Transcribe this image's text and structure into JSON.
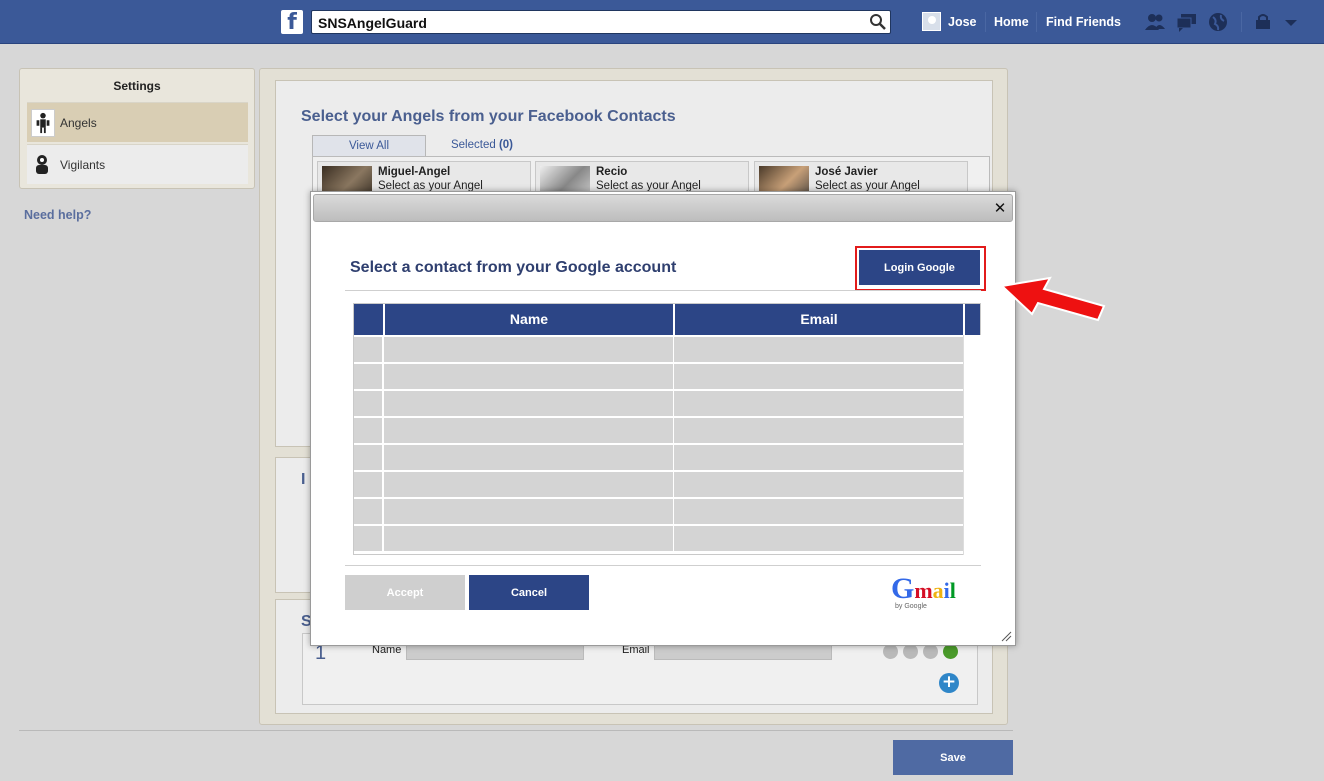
{
  "topbar": {
    "search_value": "SNSAngelGuard",
    "user_name": "Jose",
    "home": "Home",
    "find_friends": "Find Friends",
    "brand_color": "#3b5998"
  },
  "sidebar": {
    "title": "Settings",
    "items": [
      {
        "label": "Angels",
        "icon": "angel-icon",
        "active": true
      },
      {
        "label": "Vigilants",
        "icon": "vigilant-icon",
        "active": false
      }
    ],
    "help": "Need help?"
  },
  "main": {
    "title": "Select your Angels from your Facebook Contacts",
    "tab_all": "View All",
    "tab_selected": "Selected",
    "selected_count": "(0)",
    "contacts": [
      {
        "name": "Miguel-Angel",
        "action": "Select as your Angel"
      },
      {
        "name": "Recio",
        "action": "Select as your Angel"
      },
      {
        "name": "José Javier",
        "action": "Select as your Angel"
      }
    ],
    "section2_title_peek": "I",
    "section3_title_peek": "S",
    "row": {
      "number": "1",
      "name_label": "Name",
      "email_label": "Email"
    }
  },
  "modal": {
    "title": "Select a contact from your Google account",
    "login_button": "Login Google",
    "columns": [
      "Name",
      "Email"
    ],
    "accept": "Accept",
    "cancel": "Cancel",
    "logo_text": "Gmail",
    "logo_sub": "by Google",
    "close": "✕"
  },
  "footer": {
    "save": "Save"
  }
}
